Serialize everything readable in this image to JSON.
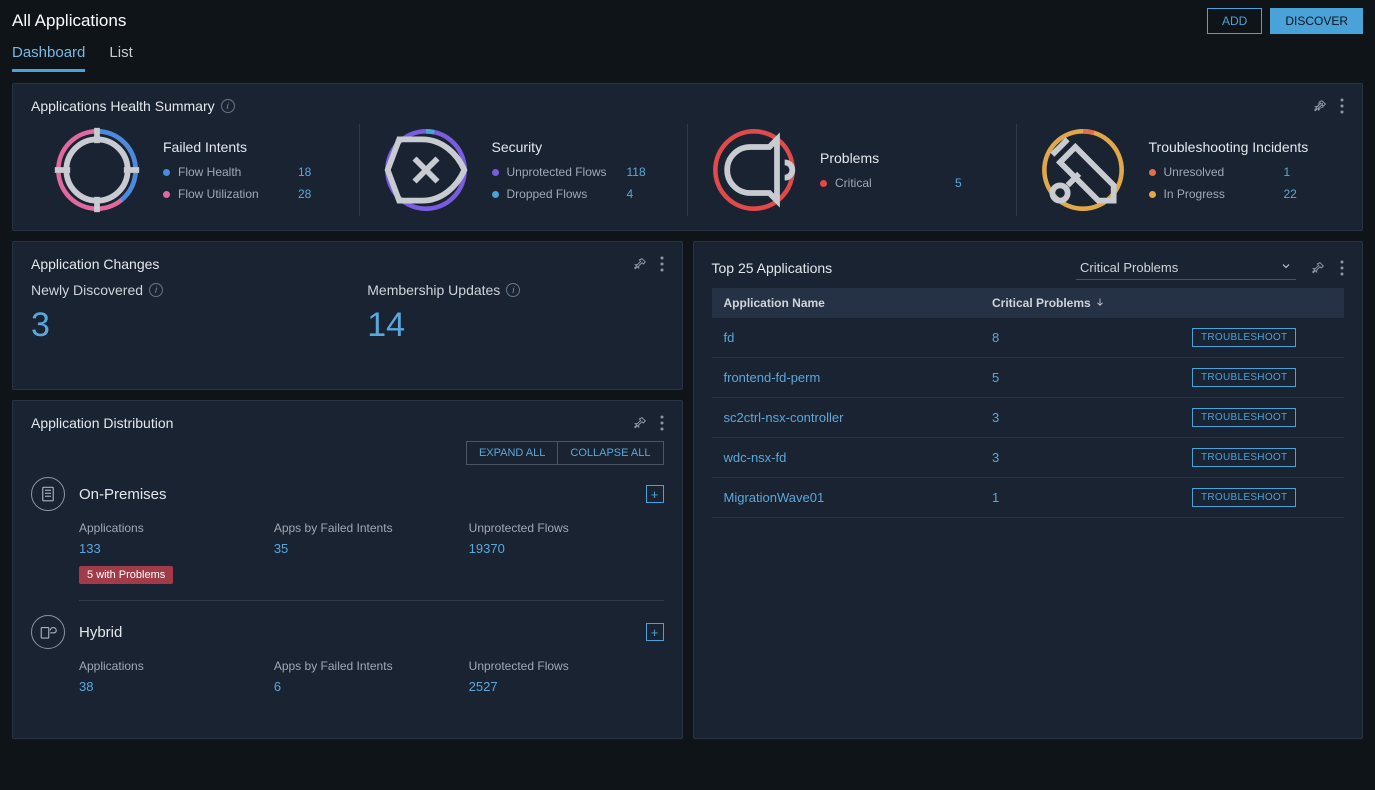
{
  "header": {
    "title": "All Applications",
    "add_label": "ADD",
    "discover_label": "DISCOVER"
  },
  "tabs": {
    "dashboard": "Dashboard",
    "list": "List"
  },
  "health_summary": {
    "title": "Applications Health Summary",
    "items": [
      {
        "title": "Failed Intents",
        "lines": [
          {
            "color": "#4a8be0",
            "label": "Flow Health",
            "value": "18"
          },
          {
            "color": "#e06aa0",
            "label": "Flow Utilization",
            "value": "28"
          }
        ]
      },
      {
        "title": "Security",
        "lines": [
          {
            "color": "#7a5ce0",
            "label": "Unprotected Flows",
            "value": "118"
          },
          {
            "color": "#4aa3d8",
            "label": "Dropped Flows",
            "value": "4"
          }
        ]
      },
      {
        "title": "Problems",
        "lines": [
          {
            "color": "#e04a4a",
            "label": "Critical",
            "value": "5"
          }
        ]
      },
      {
        "title": "Troubleshooting Incidents",
        "lines": [
          {
            "color": "#e0704a",
            "label": "Unresolved",
            "value": "1"
          },
          {
            "color": "#e0a84a",
            "label": "In Progress",
            "value": "22"
          }
        ]
      }
    ]
  },
  "changes": {
    "title": "Application Changes",
    "newly_discovered_label": "Newly Discovered",
    "newly_discovered_value": "3",
    "membership_updates_label": "Membership Updates",
    "membership_updates_value": "14"
  },
  "distribution": {
    "title": "Application Distribution",
    "expand_all": "EXPAND ALL",
    "collapse_all": "COLLAPSE ALL",
    "groups": [
      {
        "name": "On-Premises",
        "stats": [
          {
            "label": "Applications",
            "value": "133",
            "badge": "5 with Problems"
          },
          {
            "label": "Apps by Failed Intents",
            "value": "35"
          },
          {
            "label": "Unprotected Flows",
            "value": "19370"
          }
        ]
      },
      {
        "name": "Hybrid",
        "stats": [
          {
            "label": "Applications",
            "value": "38"
          },
          {
            "label": "Apps by Failed Intents",
            "value": "6"
          },
          {
            "label": "Unprotected Flows",
            "value": "2527"
          }
        ]
      }
    ]
  },
  "top_apps": {
    "title": "Top 25 Applications",
    "filter_selected": "Critical Problems",
    "col_name": "Application Name",
    "col_problems": "Critical Problems",
    "troubleshoot_label": "TROUBLESHOOT",
    "rows": [
      {
        "name": "fd",
        "problems": "8"
      },
      {
        "name": "frontend-fd-perm",
        "problems": "5"
      },
      {
        "name": "sc2ctrl-nsx-controller",
        "problems": "3"
      },
      {
        "name": "wdc-nsx-fd",
        "problems": "3"
      },
      {
        "name": "MigrationWave01",
        "problems": "1"
      }
    ]
  }
}
